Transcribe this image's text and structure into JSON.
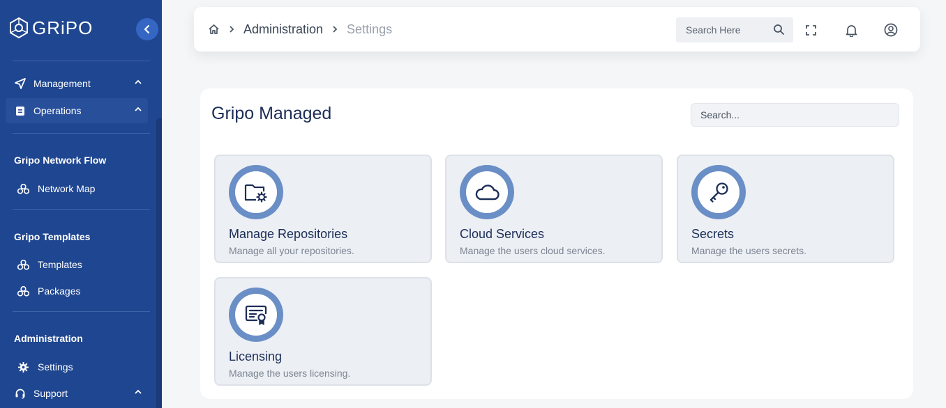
{
  "brand": {
    "name": "GRiPO"
  },
  "sidebar": {
    "groups": [
      {
        "label": "Management",
        "icon": "send-icon"
      },
      {
        "label": "Operations",
        "icon": "clipboard-icon"
      }
    ],
    "sections": [
      {
        "title": "Gripo Network Flow",
        "items": [
          {
            "label": "Network Map",
            "icon": "cubes-icon"
          }
        ]
      },
      {
        "title": "Gripo Templates",
        "items": [
          {
            "label": "Templates",
            "icon": "cubes-icon"
          },
          {
            "label": "Packages",
            "icon": "cubes-icon"
          }
        ]
      },
      {
        "title": "Administration",
        "items": [
          {
            "label": "Settings",
            "icon": "gear-icon"
          }
        ]
      }
    ],
    "support": {
      "label": "Support",
      "icon": "headset-icon"
    }
  },
  "topbar": {
    "breadcrumb": {
      "section": "Administration",
      "current": "Settings"
    },
    "search_placeholder": "Search Here"
  },
  "main": {
    "title": "Gripo Managed",
    "search_placeholder": "Search...",
    "cards": [
      {
        "title": "Manage Repositories",
        "description": "Manage all your repositories.",
        "icon": "folder-gear-icon"
      },
      {
        "title": "Cloud Services",
        "description": "Manage the users cloud services.",
        "icon": "cloud-icon"
      },
      {
        "title": "Secrets",
        "description": "Manage the users secrets.",
        "icon": "key-icon"
      },
      {
        "title": "Licensing",
        "description": "Manage the users licensing.",
        "icon": "certificate-icon"
      }
    ]
  },
  "colors": {
    "sidebar": "#1f4690",
    "accent": "#6a8ec6",
    "title": "#1c2e57"
  }
}
